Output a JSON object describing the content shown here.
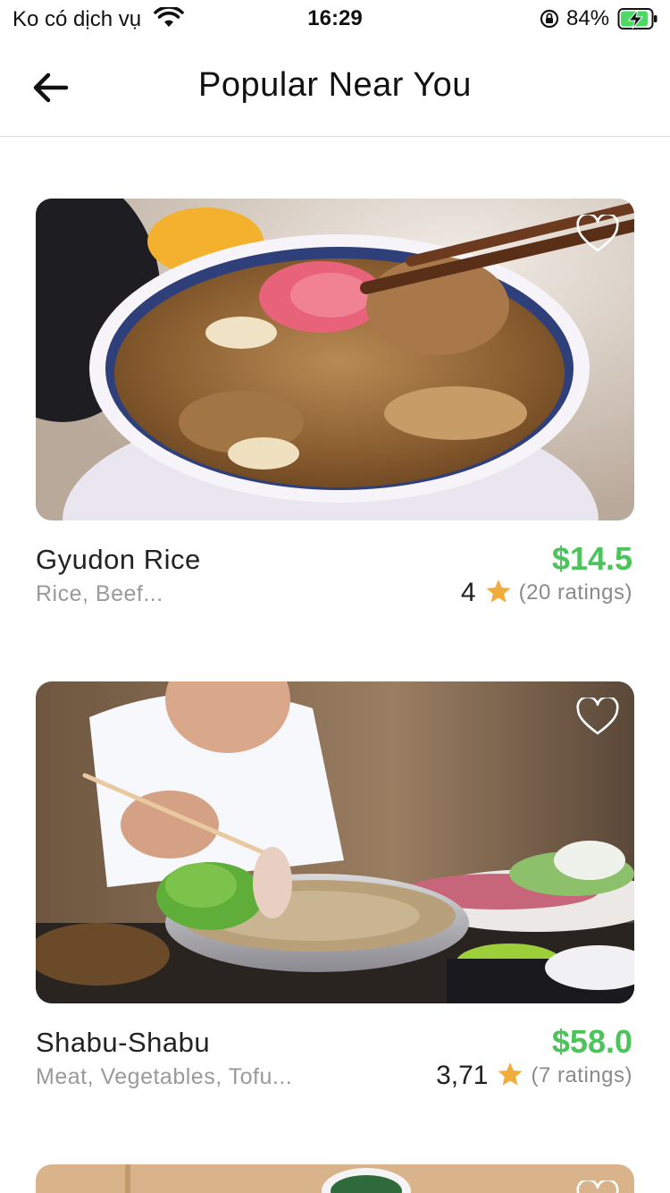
{
  "status": {
    "carrier": "Ko có dịch vụ",
    "time": "16:29",
    "battery": "84%"
  },
  "header": {
    "title": "Popular Near You"
  },
  "items": [
    {
      "name": "Gyudon Rice",
      "tags": "Rice, Beef...",
      "price": "$14.5",
      "rating": "4",
      "ratings_count": "(20 ratings)"
    },
    {
      "name": "Shabu-Shabu",
      "tags": "Meat, Vegetables, Tofu...",
      "price": "$58.0",
      "rating": "3,71",
      "ratings_count": "(7 ratings)"
    }
  ],
  "colors": {
    "price": "#4cc35b",
    "star": "#f0ad3c"
  },
  "icons": [
    "wifi-icon",
    "rotation-lock-icon",
    "battery-charging-icon",
    "back-arrow-icon",
    "heart-icon",
    "star-icon"
  ]
}
